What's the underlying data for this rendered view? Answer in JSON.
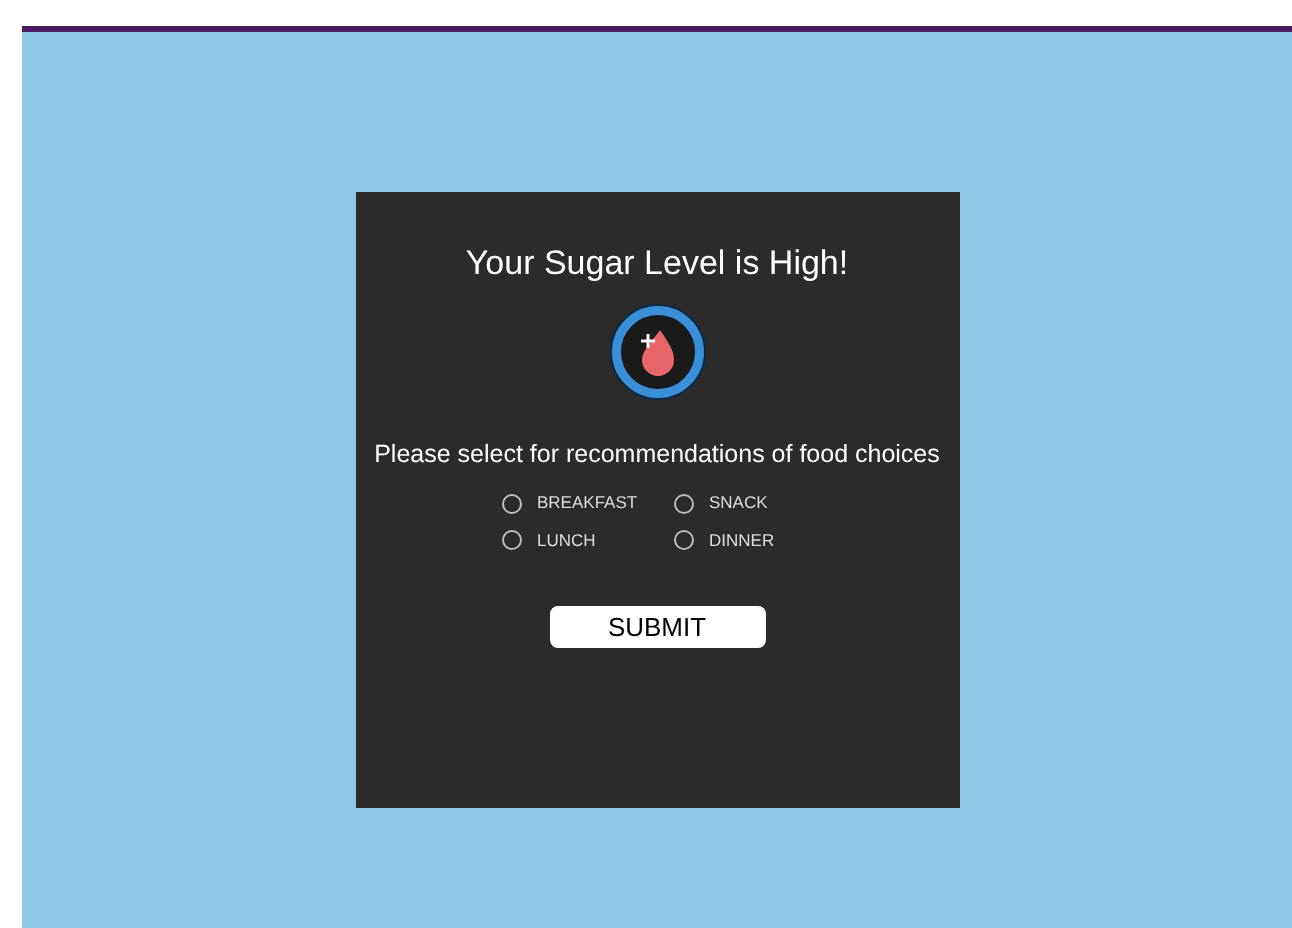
{
  "dialog": {
    "title": "Your Sugar Level is High!",
    "prompt": "Please select for recommendations of food choices",
    "options": [
      {
        "label": "BREAKFAST",
        "selected": false
      },
      {
        "label": "SNACK",
        "selected": false
      },
      {
        "label": "LUNCH",
        "selected": false
      },
      {
        "label": "DINNER",
        "selected": false
      }
    ],
    "submit": "SUBMIT"
  }
}
